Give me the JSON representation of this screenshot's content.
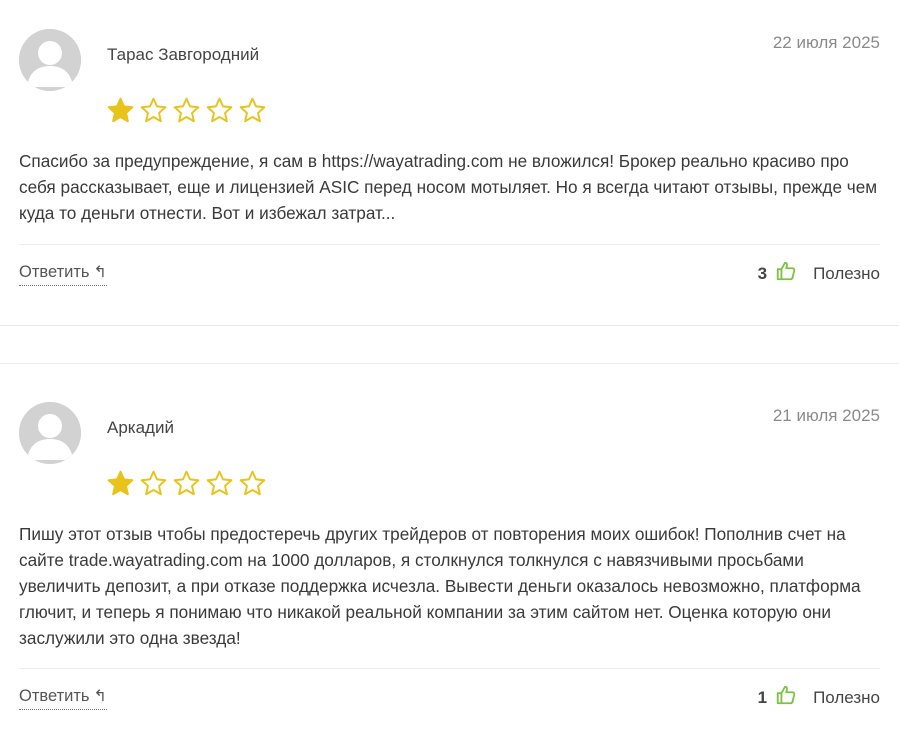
{
  "reviews": [
    {
      "author": "Тарас Завгородний",
      "date": "22 июля 2025",
      "rating": 1,
      "max_rating": 5,
      "text": "Спасибо за предупреждение, я сам в https://wayatrading.com не вложился! Брокер реально красиво про себя рассказывает, еще и лицензией ASIC перед носом мотыляет. Но я всегда читают отзывы, прежде чем куда то деньги отнести. Вот и избежал затрат...",
      "reply_label": "Ответить",
      "helpful_count": "3",
      "helpful_label": "Полезно"
    },
    {
      "author": "Аркадий",
      "date": "21 июля 2025",
      "rating": 1,
      "max_rating": 5,
      "text": "Пишу этот отзыв чтобы предостеречь других трейдеров от повторения моих ошибок! Пополнив счет на сайте trade.wayatrading.com на 1000 долларов, я столкнулся толкнулся с навязчивыми просьбами увеличить депозит, а при отказе поддержка исчезла. Вывести деньги оказалось невозможно, платформа глючит, и теперь я понимаю что никакой реальной компании за этим сайтом нет. Оценка которую они заслужили это одна звезда!",
      "reply_label": "Ответить",
      "helpful_count": "1",
      "helpful_label": "Полезно"
    }
  ],
  "colors": {
    "star": "#e8c31a",
    "thumb": "#7cc242",
    "avatar_bg": "#cfcfcf"
  },
  "icons": {
    "reply": "reply-arrow-icon",
    "helpful": "thumbs-up-icon",
    "avatar": "user-avatar-icon",
    "star": "star-icon"
  }
}
